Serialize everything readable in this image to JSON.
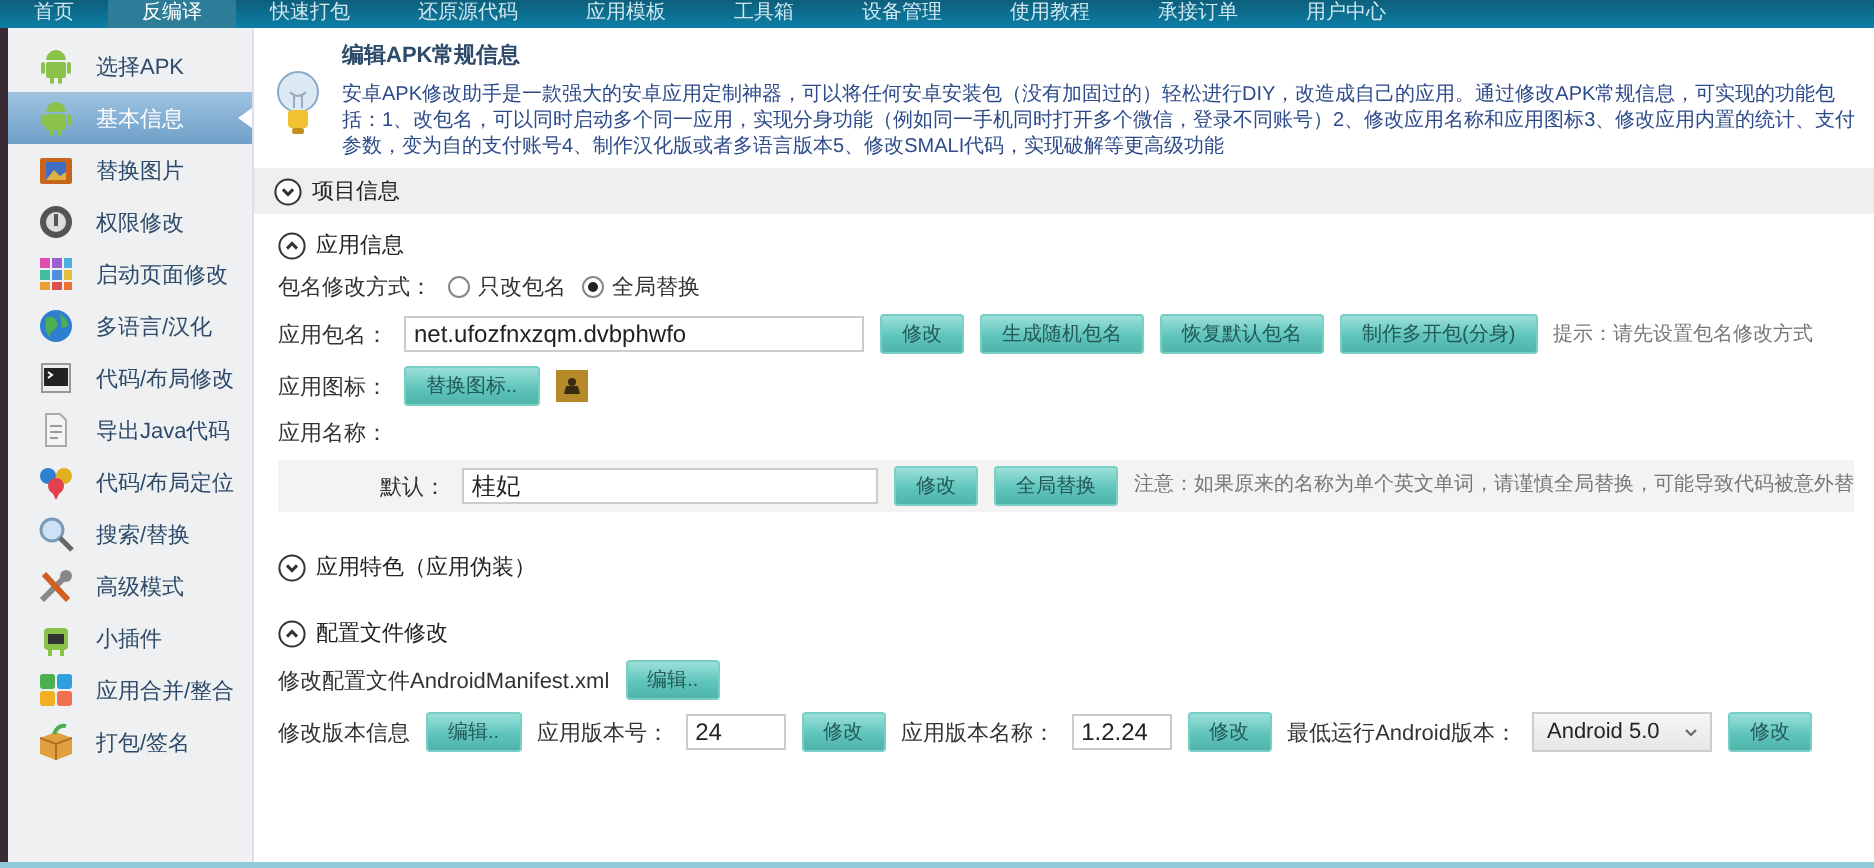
{
  "nav": [
    {
      "label": "首页",
      "selected": false
    },
    {
      "label": "反编译",
      "selected": true
    },
    {
      "label": "快速打包",
      "selected": false
    },
    {
      "label": "还原源代码",
      "selected": false
    },
    {
      "label": "应用模板",
      "selected": false
    },
    {
      "label": "工具箱",
      "selected": false
    },
    {
      "label": "设备管理",
      "selected": false
    },
    {
      "label": "使用教程",
      "selected": false
    },
    {
      "label": "承接订单",
      "selected": false
    },
    {
      "label": "用户中心",
      "selected": false
    }
  ],
  "sidebar": {
    "items": [
      {
        "label": "选择APK",
        "selected": false
      },
      {
        "label": "基本信息",
        "selected": true
      },
      {
        "label": "替换图片",
        "selected": false
      },
      {
        "label": "权限修改",
        "selected": false
      },
      {
        "label": "启动页面修改",
        "selected": false
      },
      {
        "label": "多语言/汉化",
        "selected": false
      },
      {
        "label": "代码/布局修改",
        "selected": false
      },
      {
        "label": "导出Java代码",
        "selected": false
      },
      {
        "label": "代码/布局定位",
        "selected": false
      },
      {
        "label": "搜索/替换",
        "selected": false
      },
      {
        "label": "高级模式",
        "selected": false
      },
      {
        "label": "小插件",
        "selected": false
      },
      {
        "label": "应用合并/整合",
        "selected": false
      },
      {
        "label": "打包/签名",
        "selected": false
      }
    ]
  },
  "intro": {
    "title": "编辑APK常规信息",
    "text": "安卓APK修改助手是一款强大的安卓应用定制神器，可以将任何安卓安装包（没有加固过的）轻松进行DIY，改造成自己的应用。通过修改APK常规信息，可实现的功能包括：1、改包名，可以同时启动多个同一应用，实现分身功能（例如同一手机同时打开多个微信，登录不同账号）2、修改应用名称和应用图标3、修改应用内置的统计、支付参数，变为自的支付账号4、制作汉化版或者多语言版本5、修改SMALI代码，实现破解等更高级功能"
  },
  "project_info": {
    "title": "项目信息",
    "expanded": false
  },
  "app_info": {
    "title": "应用信息",
    "expanded": true,
    "package_mode": {
      "label": "包名修改方式：",
      "options": [
        {
          "label": "只改包名",
          "selected": false
        },
        {
          "label": "全局替换",
          "selected": true
        }
      ]
    },
    "package_name": {
      "label": "应用包名：",
      "value": "net.ufozfnxzqm.dvbphwfo",
      "buttons": [
        "修改",
        "生成随机包名",
        "恢复默认包名",
        "制作多开包(分身)"
      ],
      "hint": "提示：请先设置包名修改方式"
    },
    "app_icon": {
      "label": "应用图标：",
      "button": "替换图标.."
    },
    "app_name": {
      "label": "应用名称：",
      "default_label": "默认：",
      "value": "桂妃",
      "buttons": [
        "修改",
        "全局替换"
      ],
      "note": "注意：如果原来的名称为单个英文单词，请谨慎全局替换，可能导致代码被意外替"
    }
  },
  "app_features": {
    "title": "应用特色（应用伪装）",
    "expanded": false
  },
  "config": {
    "title": "配置文件修改",
    "expanded": true,
    "manifest": {
      "label": "修改配置文件AndroidManifest.xml",
      "button": "编辑.."
    },
    "version": {
      "label": "修改版本信息",
      "button": "编辑..",
      "code_label": "应用版本号：",
      "code_value": "24",
      "code_button": "修改",
      "name_label": "应用版本名称：",
      "name_value": "1.2.24",
      "name_button": "修改",
      "min_label": "最低运行Android版本：",
      "min_value": "Android 5.0",
      "min_button": "修改"
    }
  }
}
